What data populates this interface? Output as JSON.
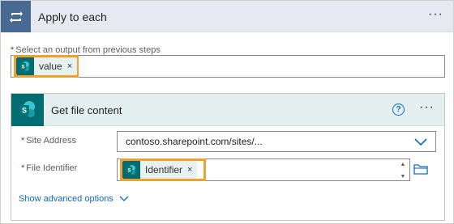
{
  "apply_to_each": {
    "title": "Apply to each",
    "menu_label": "···",
    "select_label": "Select an output from previous steps",
    "required_marker": "*",
    "token": {
      "label": "value",
      "remove": "×",
      "icon": "sharepoint-icon"
    },
    "icon": "loop-icon"
  },
  "get_file_content": {
    "title": "Get file content",
    "help_label": "?",
    "menu_label": "···",
    "icon": "sharepoint-icon",
    "fields": {
      "site_address": {
        "label": "Site Address",
        "value": "contoso.sharepoint.com/sites/..."
      },
      "file_identifier": {
        "label": "File Identifier",
        "token": {
          "label": "Identifier",
          "remove": "×"
        }
      }
    },
    "advanced_link": "Show advanced options"
  },
  "colors": {
    "loop_blue": "#486991",
    "sharepoint_teal": "#036c70",
    "highlight_orange": "#f0a030",
    "link_blue": "#0f6cbd",
    "required_red": "#a4262c"
  }
}
